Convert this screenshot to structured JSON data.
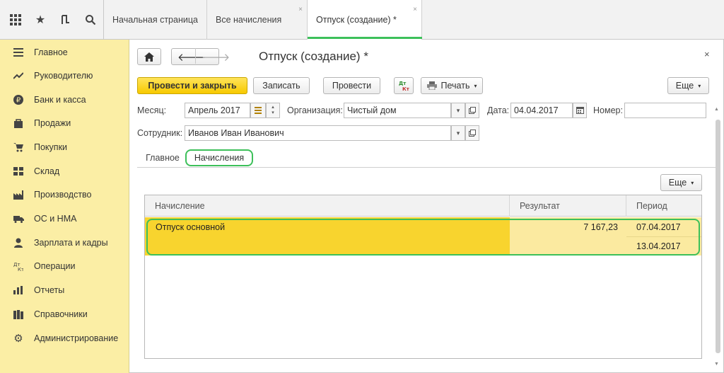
{
  "tabs": [
    {
      "label": "Начальная страница"
    },
    {
      "label": "Все начисления",
      "close": "×"
    },
    {
      "label": "Отпуск (создание) *",
      "close": "×"
    }
  ],
  "sidebar": {
    "items": [
      {
        "label": "Главное"
      },
      {
        "label": "Руководителю"
      },
      {
        "label": "Банк и касса"
      },
      {
        "label": "Продажи"
      },
      {
        "label": "Покупки"
      },
      {
        "label": "Склад"
      },
      {
        "label": "Производство"
      },
      {
        "label": "ОС и НМА"
      },
      {
        "label": "Зарплата и кадры"
      },
      {
        "label": "Операции"
      },
      {
        "label": "Отчеты"
      },
      {
        "label": "Справочники"
      },
      {
        "label": "Администрирование"
      }
    ]
  },
  "form": {
    "title": "Отпуск (создание) *",
    "close": "×",
    "buttons": {
      "post_close": "Провести и закрыть",
      "save": "Записать",
      "post": "Провести",
      "print": "Печать",
      "more": "Еще",
      "dtkt": "Дт Кт"
    },
    "fields": {
      "month_label": "Месяц:",
      "month_value": "Апрель 2017",
      "org_label": "Организация:",
      "org_value": "Чистый дом",
      "date_label": "Дата:",
      "date_value": "04.04.2017",
      "number_label": "Номер:",
      "number_value": "",
      "employee_label": "Сотрудник:",
      "employee_value": "Иванов Иван Иванович"
    },
    "tabs": [
      {
        "label": "Главное"
      },
      {
        "label": "Начисления"
      }
    ],
    "table_more": "Еще",
    "table": {
      "headers": [
        "Начисление",
        "Результат",
        "Период"
      ],
      "rows": [
        {
          "name": "Отпуск основной",
          "result": "7 167,23",
          "period_from": "07.04.2017",
          "period_to": "13.04.2017"
        }
      ]
    }
  }
}
